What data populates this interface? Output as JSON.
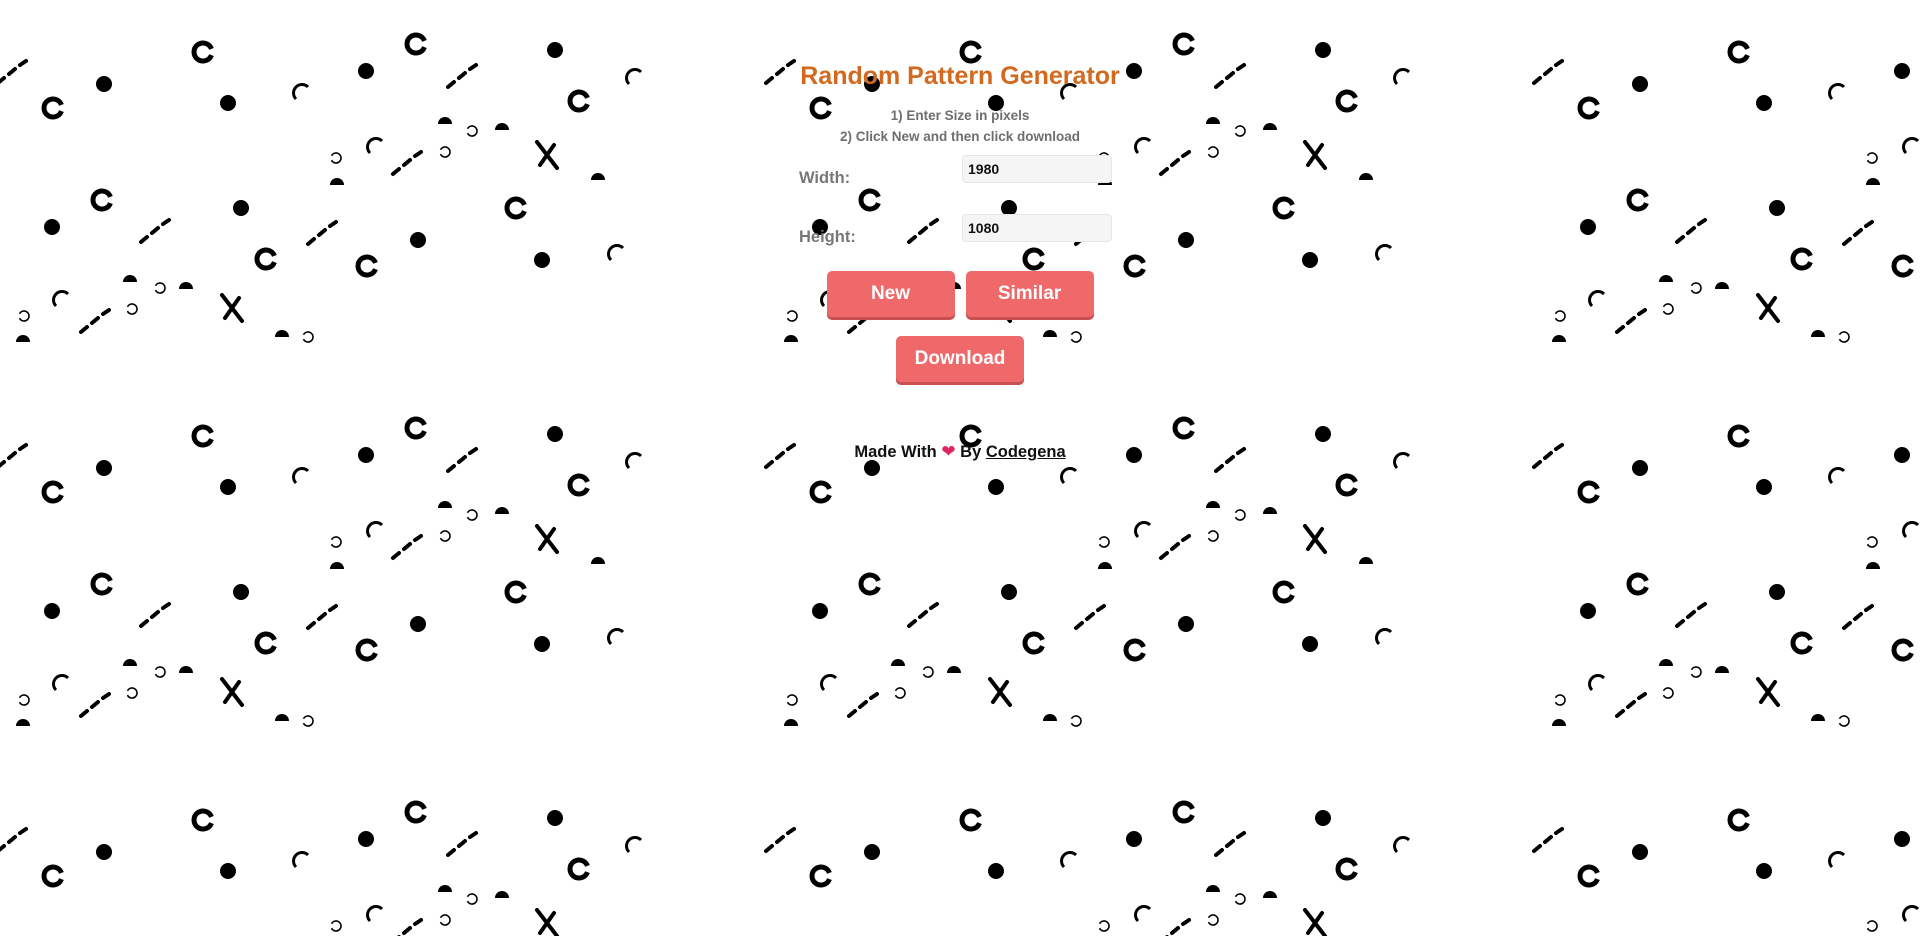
{
  "app": {
    "title": "Random Pattern Generator",
    "instruction_1": "1) Enter Size in pixels",
    "instruction_2": "2) Click New and then click download"
  },
  "form": {
    "width_label": "Width:",
    "width_value": "1980",
    "height_label": "Height:",
    "height_value": "1080"
  },
  "buttons": {
    "new_label": "New",
    "similar_label": "Similar",
    "download_label": "Download"
  },
  "footer": {
    "made_with": "Made With",
    "heart_icon": "heart-icon",
    "heart": "❤",
    "by": "By",
    "author_link": "Codegena"
  },
  "colors": {
    "title": "#d2691e",
    "button": "#f0696a",
    "heart": "#e0245e",
    "pattern": "#000000",
    "background": "#ffffff"
  }
}
